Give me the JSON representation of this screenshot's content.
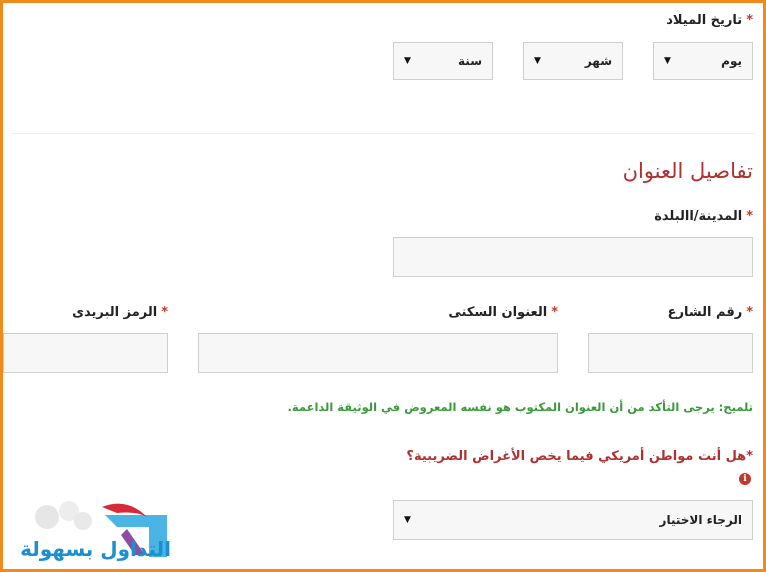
{
  "birth": {
    "label": "تاريخ الميلاد",
    "required_mark": "*",
    "day": "يوم",
    "month": "شهر",
    "year": "سنة"
  },
  "address": {
    "title": "تفاصيل العنوان",
    "city_label": "المدينة/االبلدة",
    "street_label": "رقم الشارع",
    "residential_label": "العنوان السكنى",
    "postal_label": "الرمز البريدى",
    "required_mark": "*"
  },
  "hint": "تلميح: يرجى التأكد من أن العنوان المكتوب هو نفسه المعروض في الوثيقة الداعمة.",
  "tax": {
    "question": "*هل أنت مواطن أمريكي فيما يخص الأغراض الضريبية؟",
    "info_icon_glyph": "i",
    "select_value": "الرجاء الاختيار"
  },
  "logo": {
    "text": "التداول بسهولة"
  },
  "colors": {
    "border": "#f08a1c",
    "required": "#c0392b",
    "section_title": "#b03030",
    "hint": "#3a9a3a",
    "logo": "#1b8fd0"
  }
}
